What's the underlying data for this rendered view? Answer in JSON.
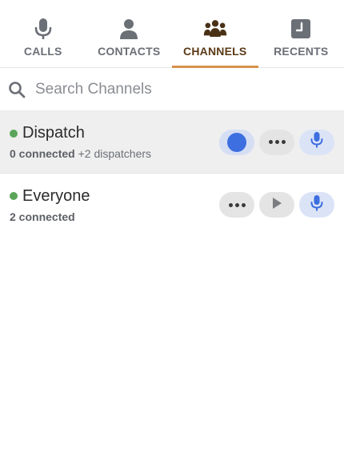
{
  "tabs": [
    {
      "label": "CALLS",
      "icon": "microphone-icon"
    },
    {
      "label": "CONTACTS",
      "icon": "person-icon"
    },
    {
      "label": "CHANNELS",
      "icon": "group-icon"
    },
    {
      "label": "RECENTS",
      "icon": "clock-icon"
    }
  ],
  "active_tab": "CHANNELS",
  "search": {
    "placeholder": "Search Channels",
    "value": ""
  },
  "channels": [
    {
      "name": "Dispatch",
      "status": "online",
      "connected_count": "0 connected",
      "extra": "+2 dispatchers",
      "selected": true,
      "actions": [
        "toggle-switch",
        "more-options",
        "push-to-talk-mic"
      ]
    },
    {
      "name": "Everyone",
      "status": "online",
      "connected_count": "2 connected",
      "extra": "",
      "selected": false,
      "actions": [
        "more-options",
        "play",
        "push-to-talk-mic"
      ]
    }
  ],
  "colors": {
    "accent_underline": "#d8914a",
    "active_tab_text": "#5b3a16",
    "online_dot": "#5ba55b",
    "toggle_blue": "#3d6fe0",
    "mic_blue": "#3d6fe0",
    "selected_row_bg": "#efefef"
  }
}
